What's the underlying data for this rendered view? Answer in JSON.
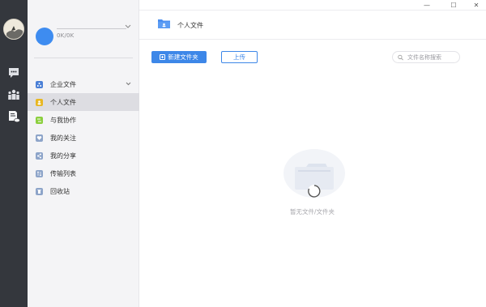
{
  "window": {
    "minimize": "—",
    "maximize": "☐",
    "close": "✕"
  },
  "profile": {
    "quota": "0K/0K"
  },
  "sidebar": {
    "items": [
      {
        "label": "企业文件",
        "color": "#4a7fd6"
      },
      {
        "label": "个人文件",
        "color": "#e8b722"
      },
      {
        "label": "与我协作",
        "color": "#8ccf3f"
      },
      {
        "label": "我的关注",
        "color": "#8da4c9"
      },
      {
        "label": "我的分享",
        "color": "#8da4c9"
      },
      {
        "label": "传输列表",
        "color": "#8da4c9"
      },
      {
        "label": "回收站",
        "color": "#8da4c9"
      }
    ],
    "active_index": 1
  },
  "header": {
    "title": "个人文件"
  },
  "toolbar": {
    "new_folder_label": "新建文件夹",
    "upload_label": "上传",
    "search_placeholder": "文件名称搜索"
  },
  "empty": {
    "message": "暂无文件/文件夹"
  },
  "colors": {
    "accent": "#3d87e8",
    "rail": "#34373d",
    "sidebar": "#f4f4f6"
  }
}
